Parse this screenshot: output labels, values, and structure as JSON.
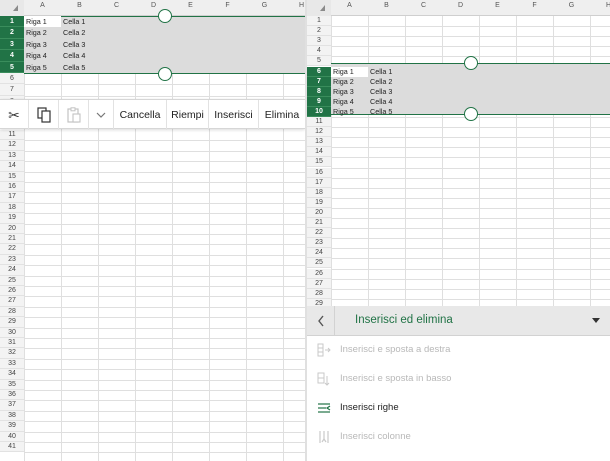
{
  "columns": [
    "A",
    "B",
    "C",
    "D",
    "E",
    "F",
    "G",
    "H"
  ],
  "left": {
    "rows_top": [
      "1",
      "2",
      "3",
      "4",
      "5",
      "6",
      "7",
      "8"
    ],
    "rows_bottom": [
      "11",
      "12",
      "13",
      "14",
      "15",
      "16",
      "17",
      "18",
      "19",
      "20",
      "21",
      "22",
      "23",
      "24",
      "25",
      "26",
      "27",
      "28",
      "29",
      "30",
      "31",
      "32",
      "33",
      "34",
      "35",
      "36",
      "37",
      "38",
      "39",
      "40",
      "41"
    ],
    "selected_rows": [
      "1",
      "2",
      "3",
      "4",
      "5"
    ],
    "cells": [
      {
        "a": "Riga 1",
        "b": "Cella 1"
      },
      {
        "a": "Riga 2",
        "b": "Cella 2"
      },
      {
        "a": "Riga 3",
        "b": "Cella 3"
      },
      {
        "a": "Riga 4",
        "b": "Cella 4"
      },
      {
        "a": "Riga 5",
        "b": "Cella 5"
      }
    ]
  },
  "toolbar": {
    "cut_icon": "scissors-icon",
    "copy_icon": "copy-icon",
    "paste_icon": "paste-icon",
    "more_icon": "chevron-down-icon",
    "clear_label": "Cancella",
    "fill_label": "Riempi",
    "insert_label": "Inserisci",
    "delete_label": "Elimina"
  },
  "right": {
    "rows": [
      "1",
      "2",
      "3",
      "4",
      "5",
      "6",
      "7",
      "8",
      "9",
      "10",
      "11",
      "12",
      "13",
      "14",
      "15",
      "16",
      "17",
      "18",
      "19",
      "20",
      "21",
      "22",
      "23",
      "24",
      "25",
      "26",
      "27",
      "28",
      "29"
    ],
    "selected_rows": [
      "6",
      "7",
      "8",
      "9",
      "10"
    ],
    "cells": [
      {
        "a": "Riga 1",
        "b": "Cella 1"
      },
      {
        "a": "Riga 2",
        "b": "Cella 2"
      },
      {
        "a": "Riga 3",
        "b": "Cella 3"
      },
      {
        "a": "Riga 4",
        "b": "Cella 4"
      },
      {
        "a": "Riga 5",
        "b": "Cella 5"
      }
    ]
  },
  "sheet": {
    "title": "Inserisci ed elimina",
    "back_icon": "chevron-left-icon",
    "dropdown_icon": "caret-down-icon",
    "items": [
      {
        "label": "Inserisci e sposta a destra",
        "enabled": false,
        "icon": "insert-shift-right-icon"
      },
      {
        "label": "Inserisci e sposta in basso",
        "enabled": false,
        "icon": "insert-shift-down-icon"
      },
      {
        "label": "Inserisci righe",
        "enabled": true,
        "icon": "insert-rows-icon"
      },
      {
        "label": "Inserisci colonne",
        "enabled": false,
        "icon": "insert-columns-icon"
      }
    ]
  },
  "colors": {
    "accent": "#217346",
    "selection_fill": "#dcdcdc",
    "disabled_text": "#b8b8b8"
  }
}
